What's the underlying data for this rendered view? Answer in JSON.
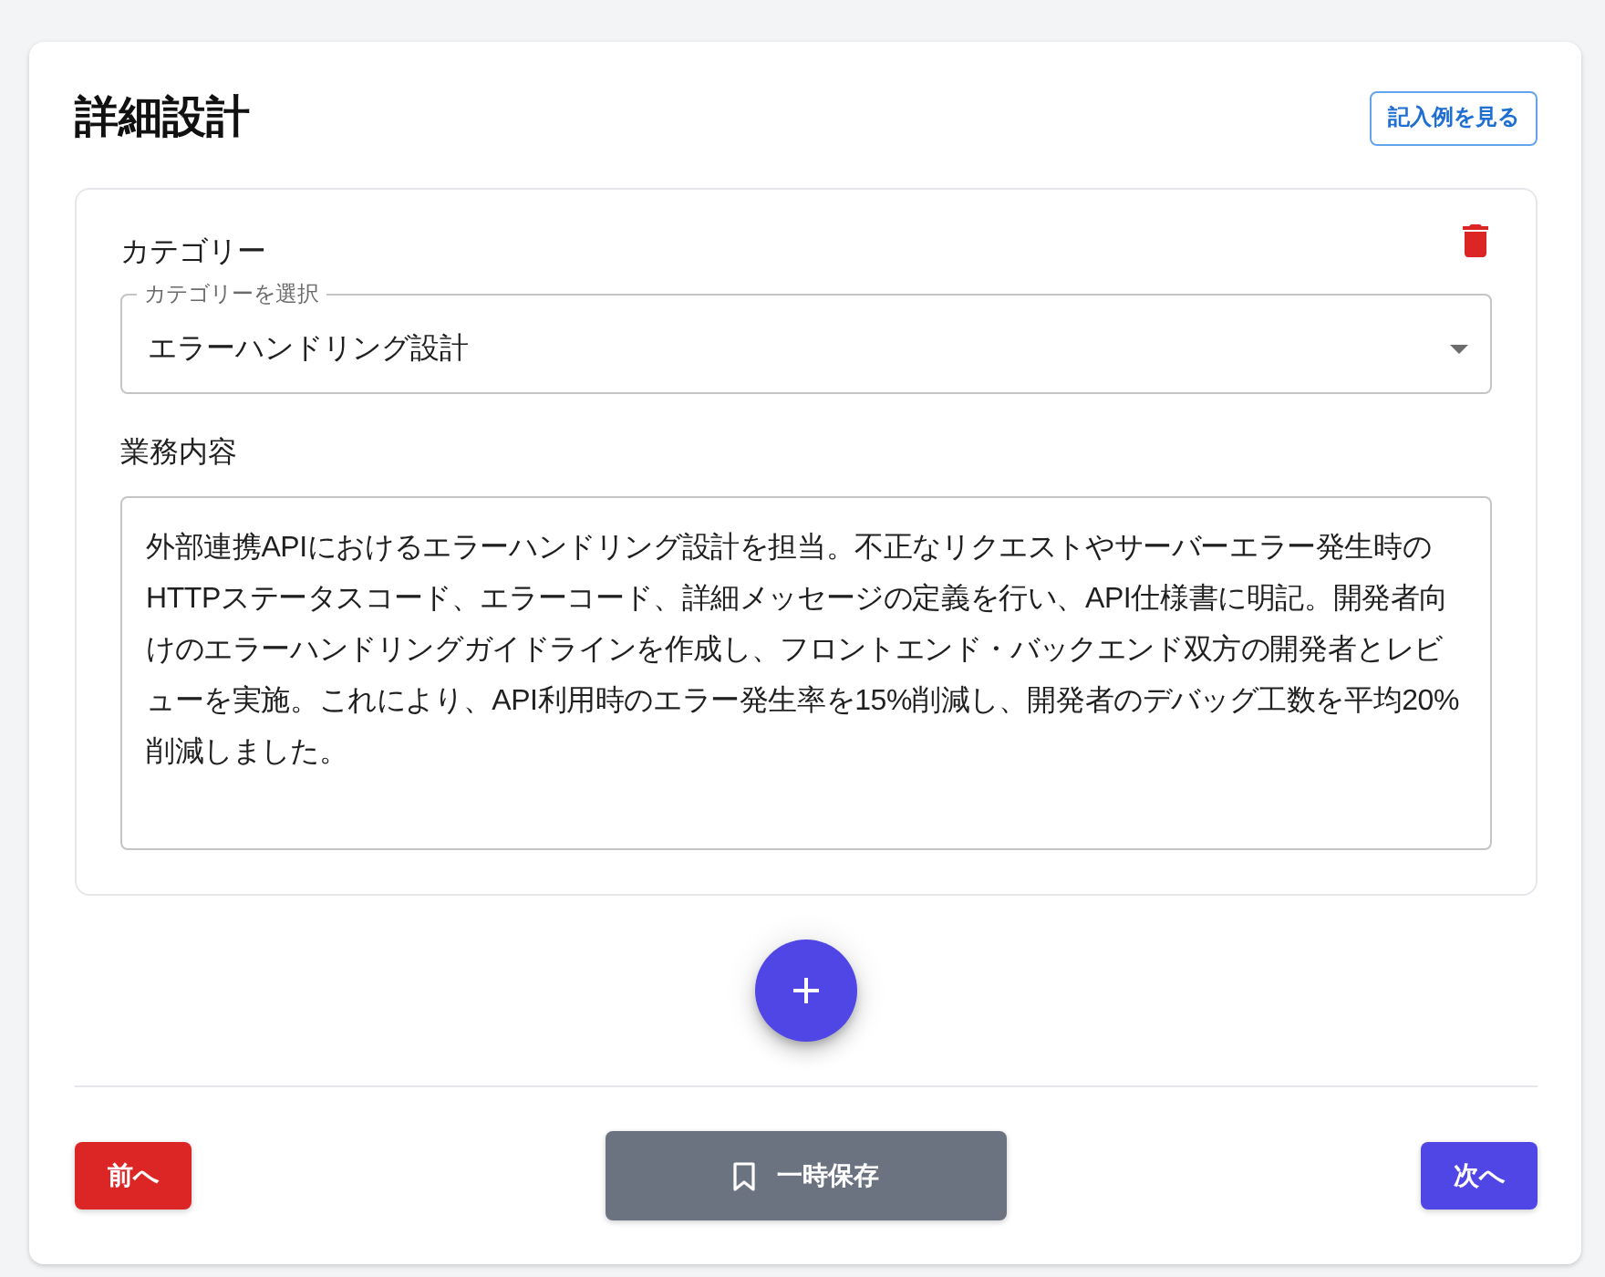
{
  "page": {
    "title": "詳細設計",
    "example_button": "記入例を見る"
  },
  "entries": [
    {
      "category_label": "カテゴリー",
      "category_select": {
        "legend": "カテゴリーを選択",
        "value": "エラーハンドリング設計"
      },
      "content_label": "業務内容",
      "content": "外部連携APIにおけるエラーハンドリング設計を担当。不正なリクエストやサーバーエラー発生時のHTTPステータスコード、エラーコード、詳細メッセージの定義を行い、API仕様書に明記。開発者向けのエラーハンドリングガイドラインを作成し、フロントエンド・バックエンド双方の開発者とレビューを実施。これにより、API利用時のエラー発生率を15%削減し、開発者のデバッグ工数を平均20%削減しました。"
    }
  ],
  "footer": {
    "previous": "前へ",
    "save": "一時保存",
    "next": "次へ"
  }
}
